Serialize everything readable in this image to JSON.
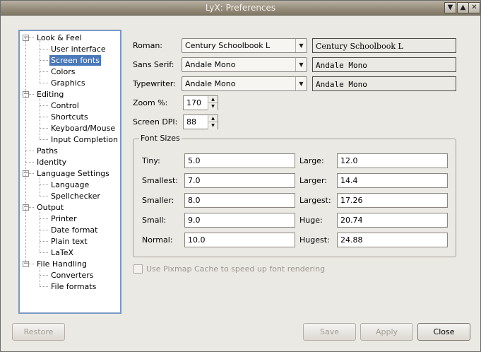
{
  "window": {
    "title": "LyX: Preferences",
    "buttons": {
      "menu": "▼",
      "shade": "▲",
      "close": "✕"
    }
  },
  "tree": {
    "items": [
      {
        "label": "Look & Feel",
        "level": 0,
        "expanded": true
      },
      {
        "label": "User interface",
        "level": 1
      },
      {
        "label": "Screen fonts",
        "level": 1,
        "selected": true
      },
      {
        "label": "Colors",
        "level": 1
      },
      {
        "label": "Graphics",
        "level": 1
      },
      {
        "label": "Editing",
        "level": 0,
        "expanded": true
      },
      {
        "label": "Control",
        "level": 1
      },
      {
        "label": "Shortcuts",
        "level": 1
      },
      {
        "label": "Keyboard/Mouse",
        "level": 1
      },
      {
        "label": "Input Completion",
        "level": 1
      },
      {
        "label": "Paths",
        "level": 0
      },
      {
        "label": "Identity",
        "level": 0
      },
      {
        "label": "Language Settings",
        "level": 0,
        "expanded": true
      },
      {
        "label": "Language",
        "level": 1
      },
      {
        "label": "Spellchecker",
        "level": 1
      },
      {
        "label": "Output",
        "level": 0,
        "expanded": true
      },
      {
        "label": "Printer",
        "level": 1
      },
      {
        "label": "Date format",
        "level": 1
      },
      {
        "label": "Plain text",
        "level": 1
      },
      {
        "label": "LaTeX",
        "level": 1
      },
      {
        "label": "File Handling",
        "level": 0,
        "expanded": true
      },
      {
        "label": "Converters",
        "level": 1
      },
      {
        "label": "File formats",
        "level": 1
      }
    ]
  },
  "fonts": {
    "roman": {
      "label": "Roman:",
      "value": "Century Schoolbook L",
      "preview": "Century Schoolbook L"
    },
    "sans": {
      "label": "Sans Serif:",
      "value": "Andale Mono",
      "preview": "Andale Mono"
    },
    "typewriter": {
      "label": "Typewriter:",
      "value": "Andale Mono",
      "preview": "Andale Mono"
    },
    "zoom": {
      "label": "Zoom %:",
      "value": "170"
    },
    "dpi": {
      "label": "Screen DPI:",
      "value": "88"
    }
  },
  "font_sizes": {
    "title": "Font Sizes",
    "tiny": {
      "label": "Tiny:",
      "value": "5.0"
    },
    "smallest": {
      "label": "Smallest:",
      "value": "7.0"
    },
    "smaller": {
      "label": "Smaller:",
      "value": "8.0"
    },
    "small": {
      "label": "Small:",
      "value": "9.0"
    },
    "normal": {
      "label": "Normal:",
      "value": "10.0"
    },
    "large": {
      "label": "Large:",
      "value": "12.0"
    },
    "larger": {
      "label": "Larger:",
      "value": "14.4"
    },
    "largest": {
      "label": "Largest:",
      "value": "17.26"
    },
    "huge": {
      "label": "Huge:",
      "value": "20.74"
    },
    "hugest": {
      "label": "Hugest:",
      "value": "24.88"
    }
  },
  "pixmap_cache": {
    "label": "Use Pixmap Cache to speed up font rendering",
    "checked": false,
    "enabled": false
  },
  "buttons": {
    "restore": "Restore",
    "save": "Save",
    "apply": "Apply",
    "close": "Close"
  },
  "colors": {
    "selection": "#4a78b9",
    "tree_border": "#7b98c4"
  }
}
